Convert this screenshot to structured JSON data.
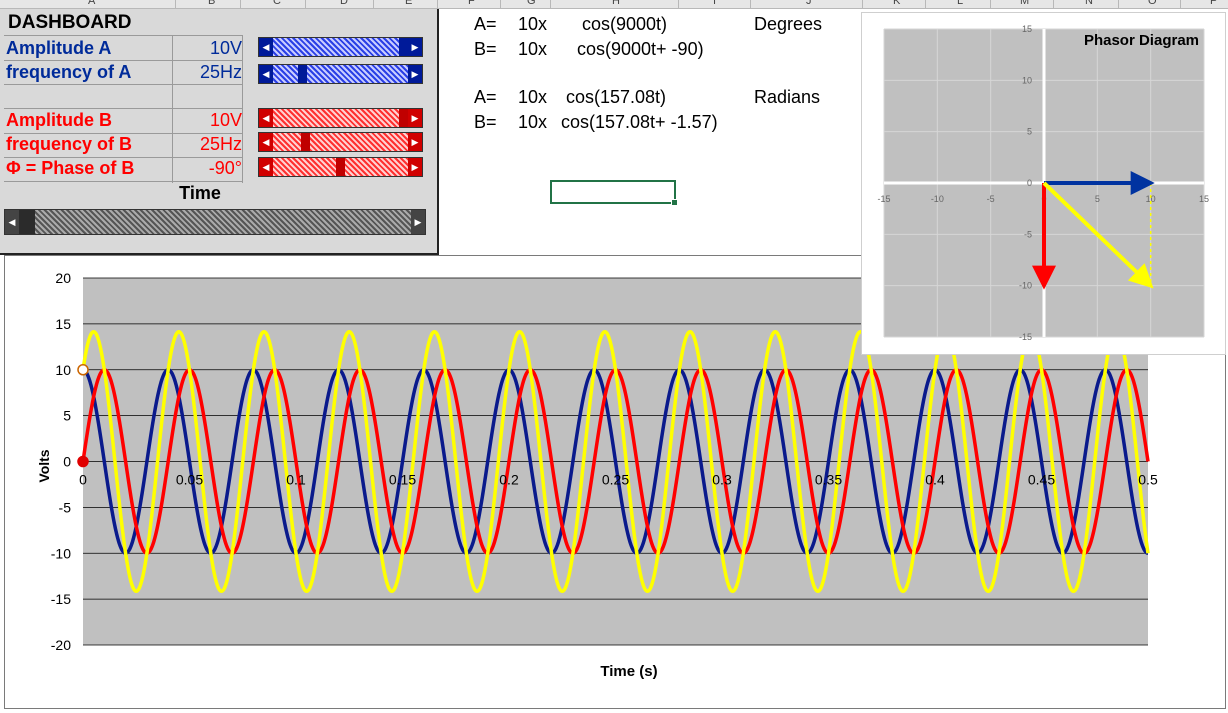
{
  "sheet": {
    "columns": [
      "A",
      "B",
      "C",
      "D",
      "E",
      "F",
      "G",
      "H",
      "I",
      "J",
      "K",
      "L",
      "M",
      "N",
      "O",
      "P"
    ]
  },
  "dashboard": {
    "title": "DASHBOARD",
    "rows": [
      {
        "label": "Amplitude A",
        "value": "10V",
        "color": "#002b9a"
      },
      {
        "label": "frequency of A",
        "value": "25Hz",
        "color": "#002b9a"
      },
      {
        "label": "Amplitude B",
        "value": "10V",
        "color": "#ff0000"
      },
      {
        "label": "frequency of B",
        "value": "25Hz",
        "color": "#ff0000"
      },
      {
        "label": "Φ = Phase of B",
        "value": "-90°",
        "color": "#ff0000"
      }
    ],
    "sliders": {
      "amplitude_a": 1.0,
      "frequency_a": 0.2,
      "amplitude_b": 1.0,
      "frequency_b": 0.22,
      "phase_b": 0.5,
      "time": 0.0
    },
    "time_label": "Time"
  },
  "equations": {
    "degrees": {
      "a_prefix": "A=",
      "a_amp": "10x",
      "a_expr": "cos(9000t)",
      "b_prefix": "B=",
      "b_amp": "10x",
      "b_expr": "cos(9000t+ -90)",
      "unit": "Degrees"
    },
    "radians": {
      "a_prefix": "A=",
      "a_amp": "10x",
      "a_expr": "cos(157.08t)",
      "b_prefix": "B=",
      "b_amp": "10x",
      "b_expr": "cos(157.08t+ -1.57)",
      "unit": "Radians"
    }
  },
  "chart_data": [
    {
      "type": "line",
      "xlabel": "Time (s)",
      "ylabel": "Volts",
      "xlim": [
        0,
        0.5
      ],
      "ylim": [
        -20,
        20
      ],
      "xticks": [
        "0",
        "0.05",
        "0.1",
        "0.15",
        "0.2",
        "0.25",
        "0.3",
        "0.35",
        "0.4",
        "0.45",
        "0.5"
      ],
      "yticks": [
        "20",
        "15",
        "10",
        "5",
        "0",
        "-5",
        "-10",
        "-15",
        "-20"
      ],
      "grid": true,
      "series": [
        {
          "color": "#0a1a8c",
          "amplitude": 10,
          "frequency_hz": 25,
          "phase_deg": 0
        },
        {
          "color": "#ff0000",
          "amplitude": 10,
          "frequency_hz": 25,
          "phase_deg": -90
        },
        {
          "color": "#ffff00",
          "amplitude": 14.14,
          "frequency_hz": 25,
          "phase_deg": -45
        }
      ],
      "markers": [
        {
          "x": 0,
          "y": 10,
          "color": "#ffffff",
          "stroke": "#cc6600"
        },
        {
          "x": 0,
          "y": 0,
          "color": "#e00000",
          "stroke": "#e00000"
        }
      ]
    },
    {
      "type": "scatter",
      "title": "Phasor Diagram",
      "xlim": [
        -15,
        15
      ],
      "ylim": [
        -15,
        15
      ],
      "xticks": [
        "-15",
        "-10",
        "-5",
        "0",
        "5",
        "10",
        "15"
      ],
      "yticks": [
        "15",
        "10",
        "5",
        "0",
        "-5",
        "-10",
        "-15"
      ],
      "vectors": [
        {
          "from": [
            0,
            0
          ],
          "to": [
            10,
            0
          ],
          "color": "#0033a0"
        },
        {
          "from": [
            0,
            0
          ],
          "to": [
            0,
            -10
          ],
          "color": "#ff0000"
        },
        {
          "from": [
            0,
            0
          ],
          "to": [
            10,
            -10
          ],
          "color": "#ffff00"
        }
      ]
    }
  ]
}
